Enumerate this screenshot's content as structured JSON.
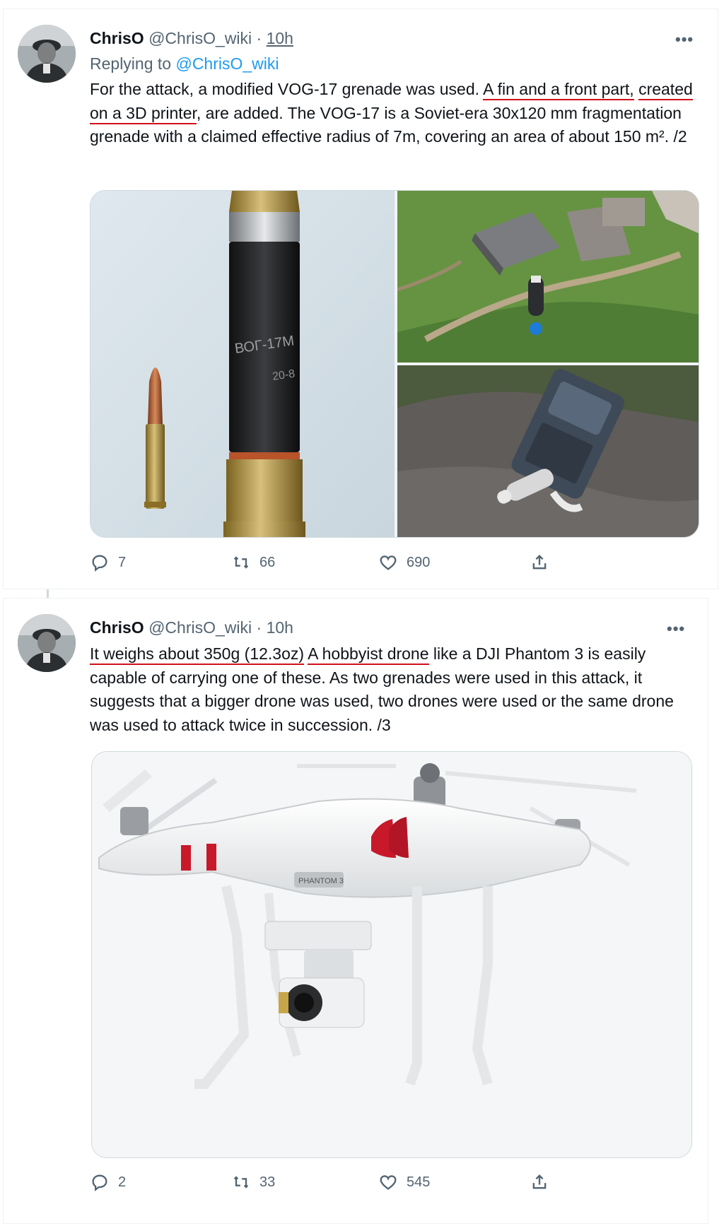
{
  "tweet1": {
    "name": "ChrisO",
    "handle": "@ChrisO_wiki",
    "separator": "·",
    "time": "10h",
    "replying_prefix": "Replying to",
    "replying_to": "@ChrisO_wiki",
    "body": {
      "t1": "For the attack, a modified VOG-17 grenade was used.",
      "t2": "A fin and a front part,",
      "t3": "created on a 3D printer",
      "t4": ", are added. The VOG-17 is a Soviet-era 30x120 mm fragmentation grenade with a claimed effective radius of 7m, covering an area of about 150 m². /2"
    },
    "grenade_marking_1": "ВОГ-17М",
    "grenade_marking_2": "20-8",
    "actions": {
      "replies": "7",
      "retweets": "66",
      "likes": "690"
    }
  },
  "tweet2": {
    "name": "ChrisO",
    "handle": "@ChrisO_wiki",
    "separator": "·",
    "time": "10h",
    "body": {
      "t1": "It weighs about 350g (12.3oz)",
      "t2": "A hobbyist drone",
      "t3": " like a DJI Phantom 3 is easily capable of carrying one of these. As two grenades were used in this attack, it suggests that a bigger drone was used, two drones were used or the same drone was used to attack twice in succession. /3"
    },
    "drone_label": "PHANTOM 3",
    "actions": {
      "replies": "2",
      "retweets": "33",
      "likes": "545"
    }
  },
  "icons": {
    "more": "more-icon",
    "reply": "reply-icon",
    "retweet": "retweet-icon",
    "like": "heart-icon",
    "share": "share-icon"
  },
  "colors": {
    "link": "#1d9bf0",
    "muted": "#536471",
    "underline": "#d0101a"
  }
}
